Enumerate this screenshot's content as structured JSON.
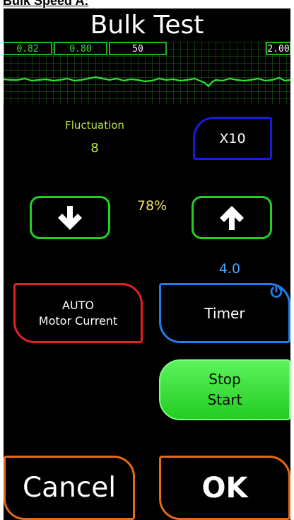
{
  "caption": "Bulk Speed A:",
  "title": "Bulk Test",
  "graph": {
    "labels": [
      "0.82",
      "0.80",
      "50",
      "2.00"
    ],
    "line_color": "#2ee62e",
    "grid_color": "#1f6a1f"
  },
  "fluctuation": {
    "label": "Fluctuation",
    "value": "8"
  },
  "x10_button": {
    "label": "X10"
  },
  "percent": "78%",
  "down_button": {
    "icon": "down-arrow-icon"
  },
  "up_button": {
    "icon": "up-arrow-icon"
  },
  "timer": {
    "value": "4.0",
    "label": "Timer",
    "icon": "power-icon"
  },
  "auto_button": {
    "line1": "AUTO",
    "line2": "Motor Current"
  },
  "stop_start_button": {
    "line1": "Stop",
    "line2": "Start"
  },
  "cancel_button": {
    "label": "Cancel"
  },
  "ok_button": {
    "label": "OK"
  },
  "colors": {
    "fluctuation_text": "#b7e645",
    "percent_text": "#f0e06a",
    "timer_text": "#4aa3ff",
    "x10_border": "#1a1adf",
    "arrow_border": "#22d022",
    "auto_border": "#e02222",
    "timer_border": "#1f7fea",
    "start_fill": "#3fe03f",
    "bottom_border": "#e36a16"
  }
}
